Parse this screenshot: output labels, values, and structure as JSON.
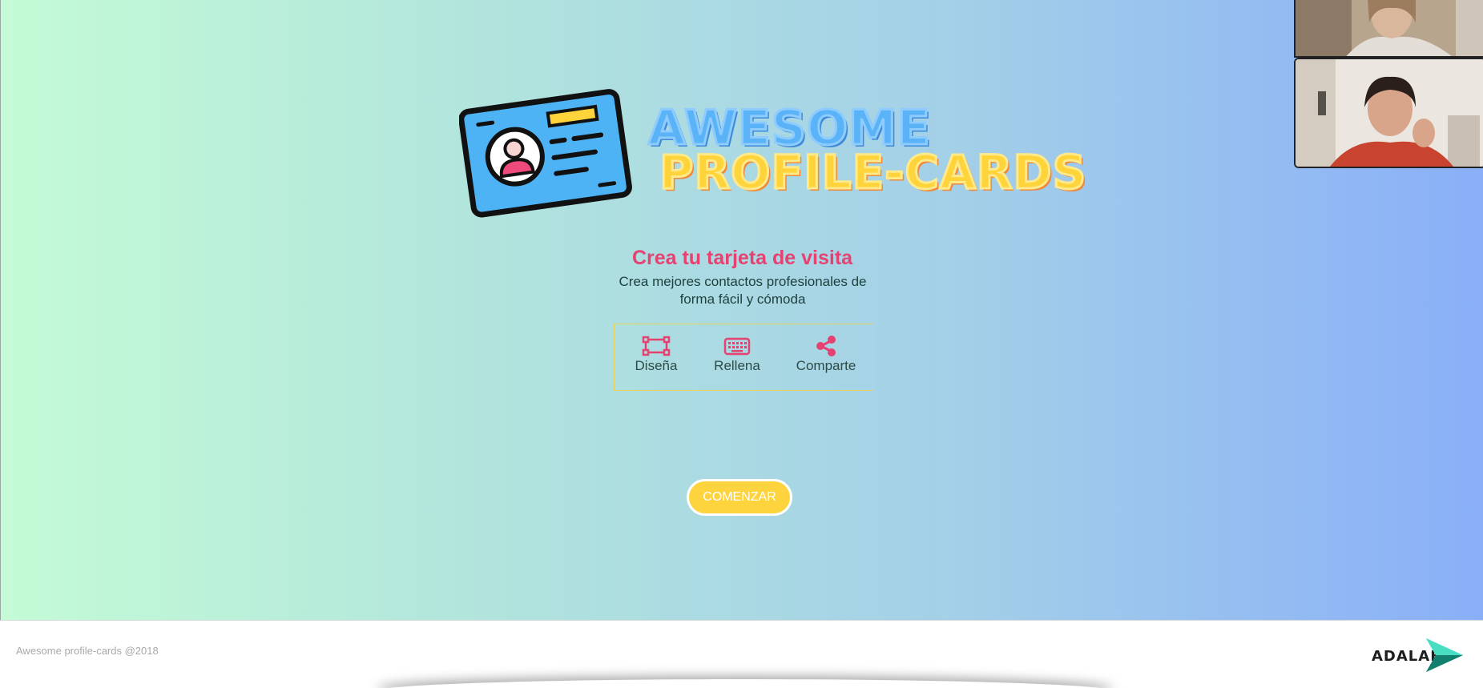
{
  "logo": {
    "line1": "AWESOME",
    "line2": "PROFILE-CARDS"
  },
  "hero": {
    "headline": "Crea tu tarjeta de visita",
    "subtitle": "Crea mejores contactos profesionales de forma fácil y cómoda"
  },
  "steps": [
    {
      "label": "Diseña",
      "icon": "object-group-icon"
    },
    {
      "label": "Rellena",
      "icon": "keyboard-icon"
    },
    {
      "label": "Comparte",
      "icon": "share-icon"
    }
  ],
  "start_button": {
    "label": "COMENZAR"
  },
  "footer": {
    "copyright": "Awesome profile-cards @2018",
    "brand": "ADALAB"
  },
  "colors": {
    "accent_pink": "#e54271",
    "button_yellow": "#fdd33e",
    "gradient_start": "#c4fbd6",
    "gradient_end": "#8aaff8"
  }
}
